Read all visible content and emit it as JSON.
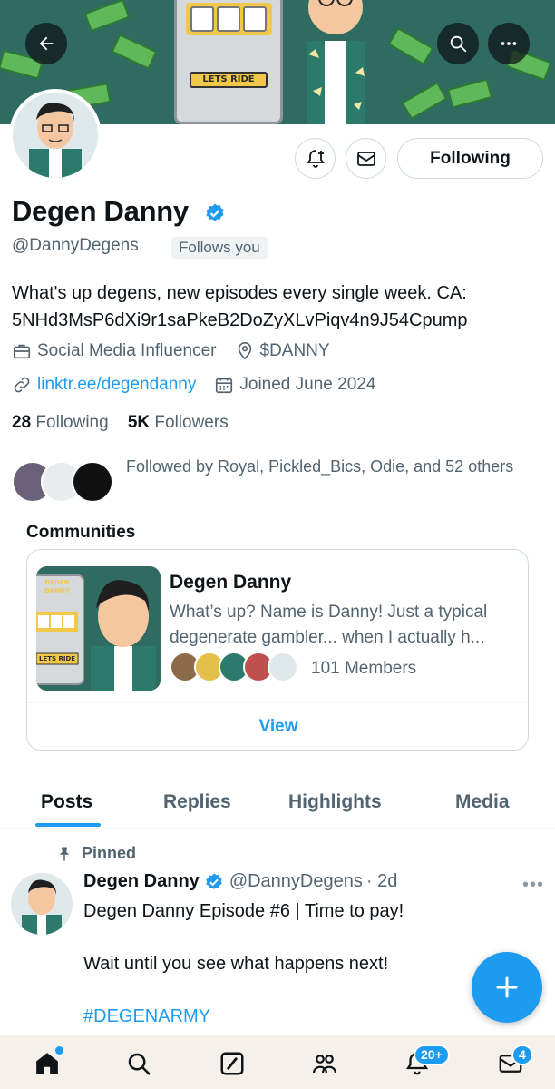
{
  "colors": {
    "accent": "#1d9bf0",
    "secondary_text": "#536471",
    "primary_text": "#0f1419",
    "banner_bg": "#2f6b60"
  },
  "banner": {
    "slot_sign": "LETS RIDE",
    "back_icon": "arrow-left-icon",
    "search_icon": "search-icon",
    "more_icon": "more-horizontal-icon"
  },
  "actions": {
    "notify_icon": "bell-plus-icon",
    "message_icon": "envelope-icon",
    "follow_label": "Following"
  },
  "profile": {
    "name": "Degen Danny",
    "handle": "@DannyDegens",
    "follows_you": "Follows you",
    "bio_line1": "What's up degens, new episodes every single week. CA:",
    "bio_line2": "5NHd3MsP6dXi9r1saPkeB2DoZyXLvPiqv4n9J54Cpump",
    "category": "Social Media Influencer",
    "location": "$DANNY",
    "link": "linktr.ee/degendanny",
    "joined": "Joined June 2024",
    "following_count": "28",
    "following_label": "Following",
    "followers_count": "5K",
    "followers_label": "Followers",
    "followed_by": "Followed by Royal, Pickled_Bics, Odie, and 52 others"
  },
  "community": {
    "section_title": "Communities",
    "name": "Degen Danny",
    "description": "What’s up? Name is Danny! Just a typical degenerate gambler... when I actually h...",
    "members": "101 Members",
    "view_label": "View",
    "image_sign": "LETS RIDE",
    "image_banner": "DEGEN DANNY"
  },
  "tabs": [
    "Posts",
    "Replies",
    "Highlights",
    "Media"
  ],
  "post": {
    "pinned_label": "Pinned",
    "author": "Degen Danny",
    "handle": "@DannyDegens",
    "time": "· 2d",
    "line1": "Degen Danny Episode #6 | Time to pay!",
    "line2": "Wait until you see what happens next!",
    "hashtag": "#DEGENARMY"
  },
  "bottom_nav": {
    "items": [
      "home-icon",
      "search-icon",
      "grok-icon",
      "communities-icon",
      "notifications-icon",
      "messages-icon"
    ],
    "notifications_badge": "20+",
    "messages_badge": "4"
  }
}
